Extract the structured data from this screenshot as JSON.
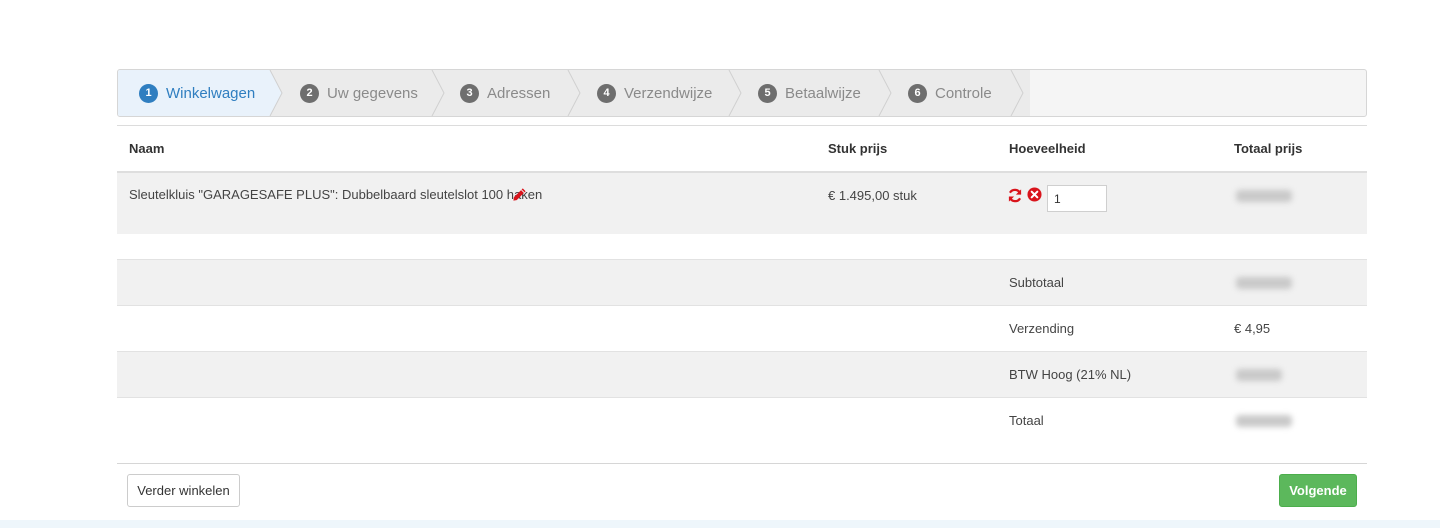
{
  "stepper": {
    "steps": [
      {
        "num": "1",
        "label": "Winkelwagen",
        "active": true
      },
      {
        "num": "2",
        "label": "Uw gegevens",
        "active": false
      },
      {
        "num": "3",
        "label": "Adressen",
        "active": false
      },
      {
        "num": "4",
        "label": "Verzendwijze",
        "active": false
      },
      {
        "num": "5",
        "label": "Betaalwijze",
        "active": false
      },
      {
        "num": "6",
        "label": "Controle",
        "active": false
      }
    ]
  },
  "table": {
    "headers": {
      "name": "Naam",
      "unit_price": "Stuk prijs",
      "quantity": "Hoeveelheid",
      "total_price": "Totaal prijs"
    },
    "items": [
      {
        "name": "Sleutelkluis \"GARAGESAFE PLUS\": Dubbelbaard sleutelslot 100 haken",
        "unit_price": "€ 1.495,00 stuk",
        "quantity": "1"
      }
    ]
  },
  "summary": {
    "subtotal_label": "Subtotaal",
    "shipping_label": "Verzending",
    "shipping_value": "€ 4,95",
    "vat_label": "BTW Hoog (21% NL)",
    "total_label": "Totaal"
  },
  "buttons": {
    "continue_shopping": "Verder winkelen",
    "next": "Volgende"
  },
  "colors": {
    "accent": "#2f7ec0",
    "icon_red": "#d9141c",
    "next_green": "#5cb85c"
  },
  "icons": [
    "pencil-icon",
    "refresh-icon",
    "remove-icon"
  ]
}
